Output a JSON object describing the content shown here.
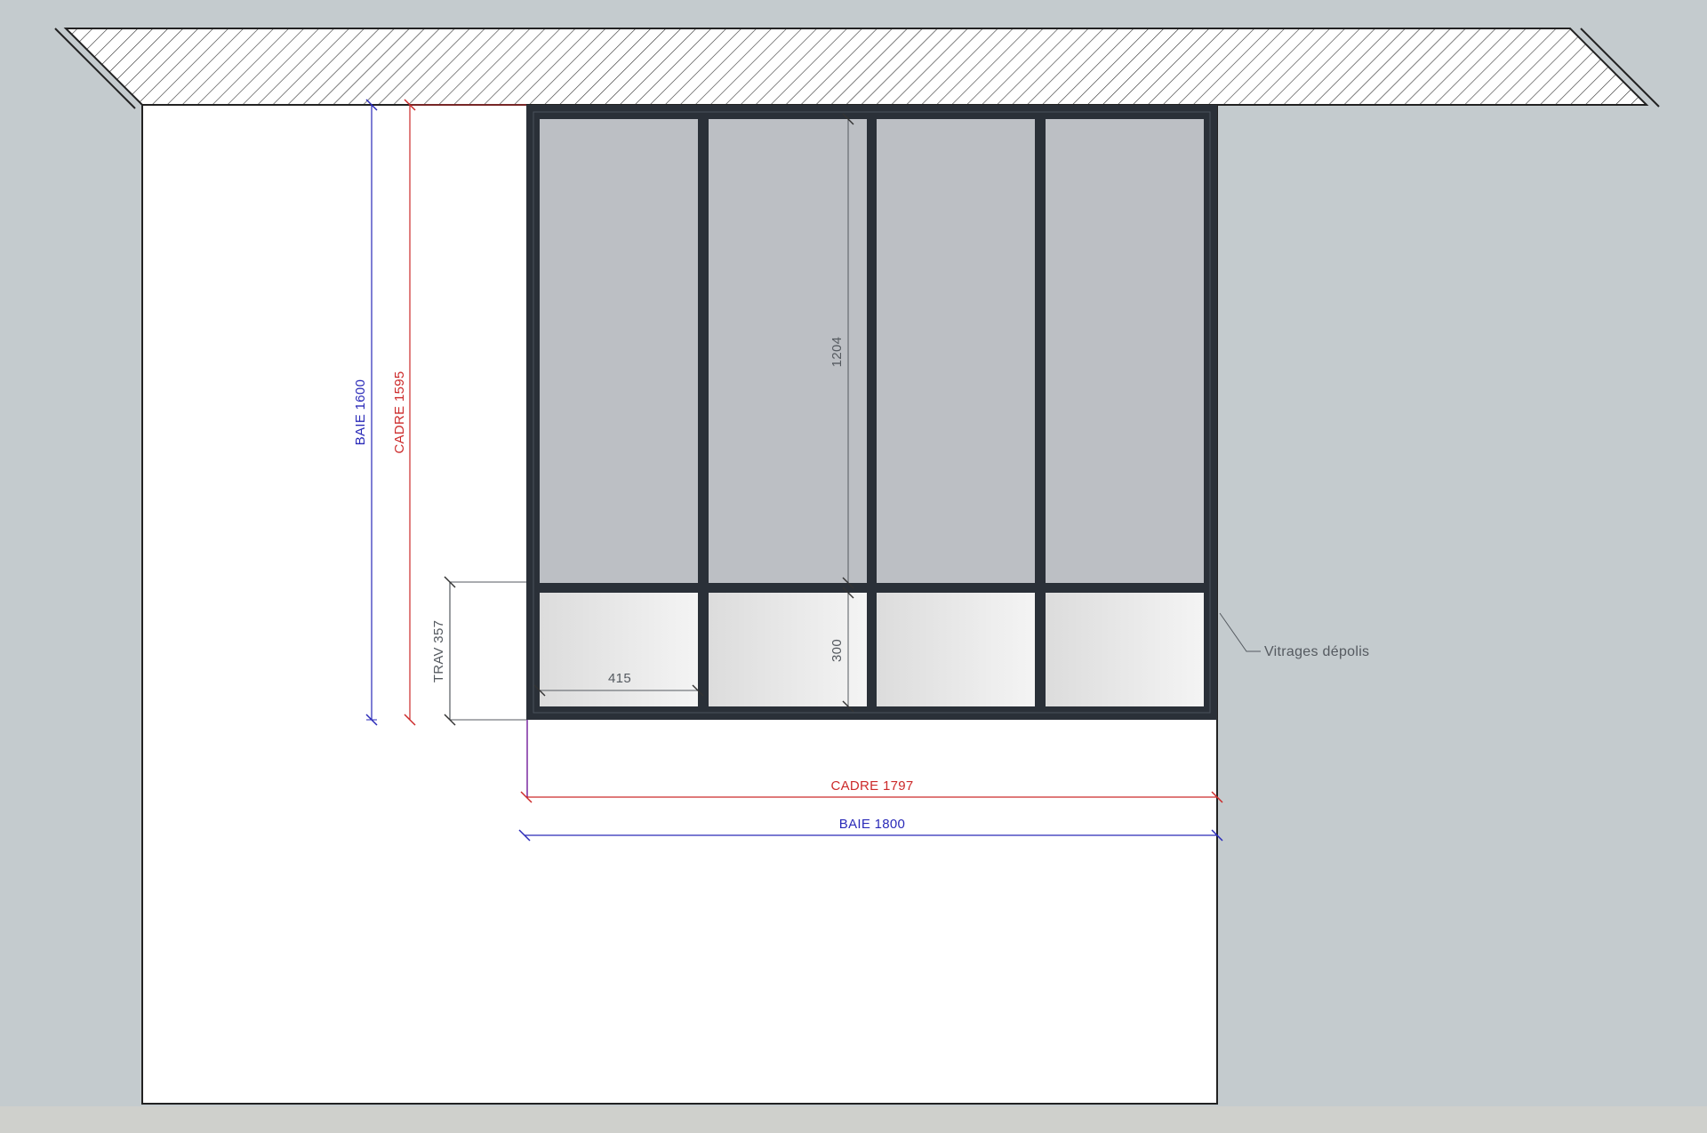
{
  "drawing": {
    "dimensions": {
      "baie_height": "BAIE 1600",
      "cadre_height": "CADRE 1595",
      "trav_height": "TRAV 357",
      "upper_pane_height": "1204",
      "lower_pane_height": "300",
      "pane_width": "415",
      "cadre_width": "CADRE 1797",
      "baie_width": "BAIE 1800"
    },
    "callout": "Vitrages dépolis"
  },
  "colors": {
    "background": "#c4cbce",
    "floor": "#cfd0cc",
    "wall": "#ffffff",
    "frame": "#2a3038",
    "glass_clear": "#bcbfc4",
    "glass_frosted": "#e9e9e9",
    "dim_blue": "#2a2ab8",
    "dim_red": "#cc2a2a",
    "dim_gray": "#555a60"
  }
}
